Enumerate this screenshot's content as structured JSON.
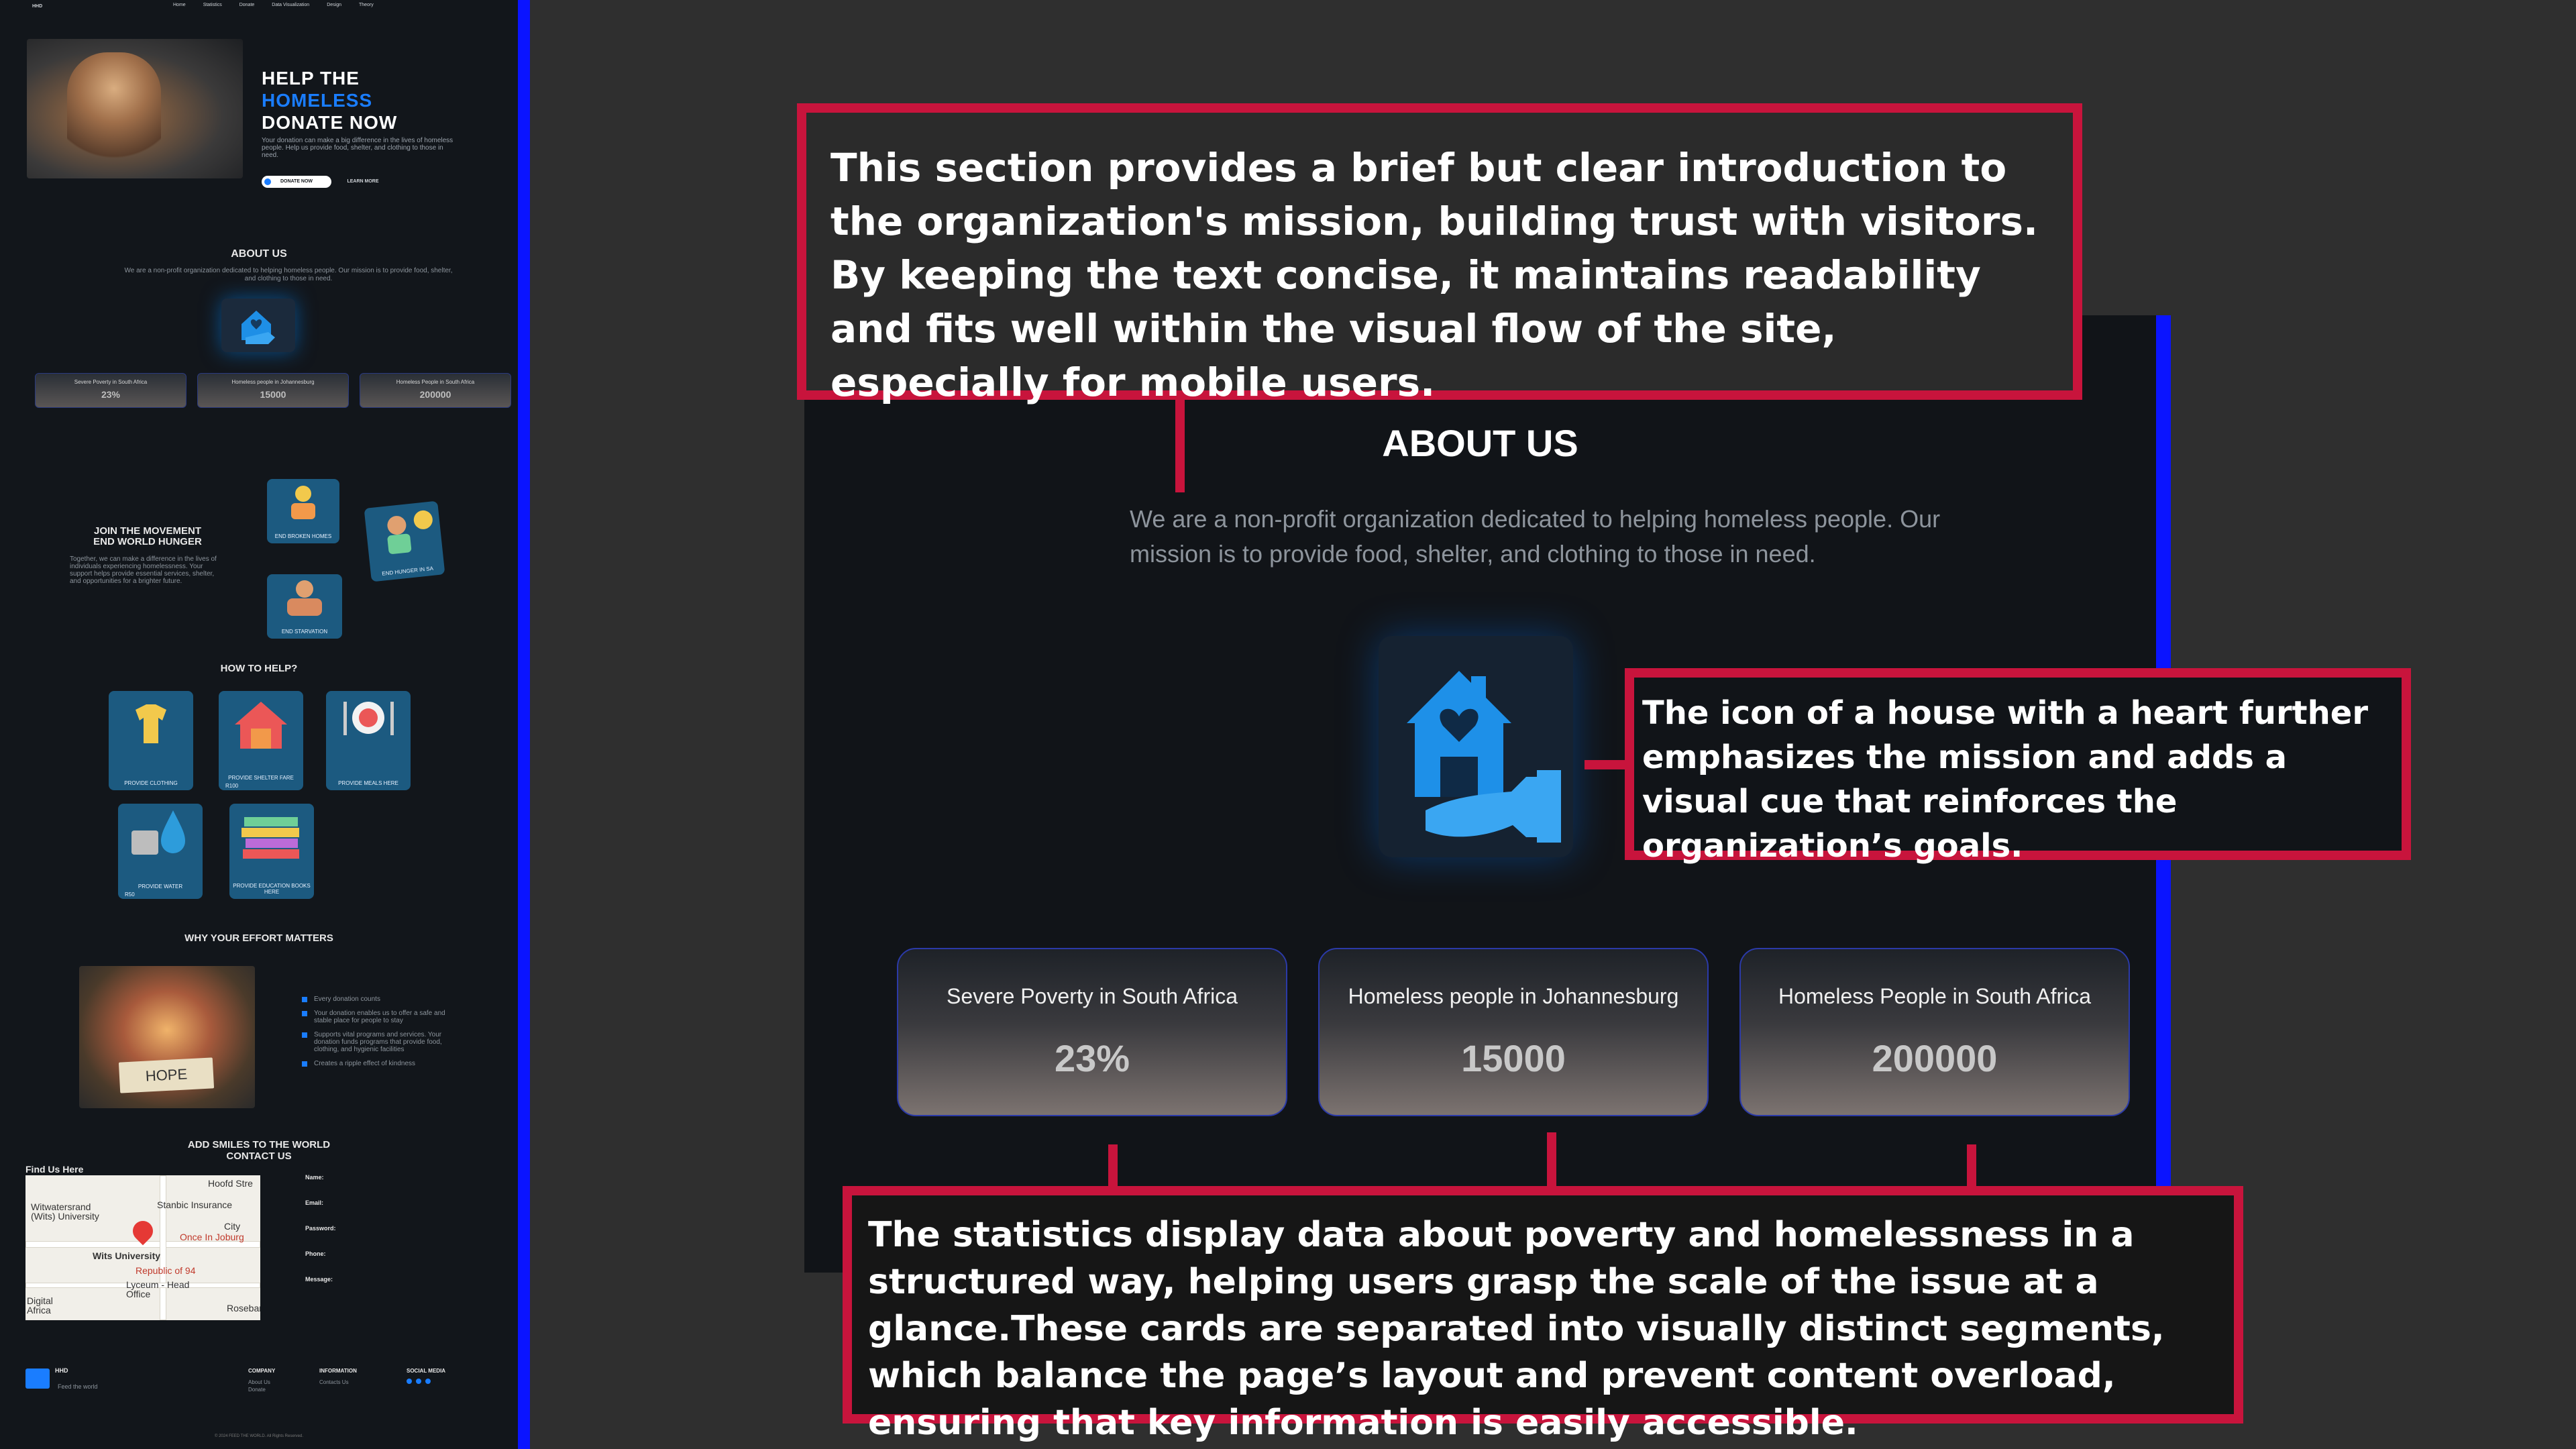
{
  "thumbnail": {
    "nav": {
      "logo": "HHD",
      "links": [
        "Home",
        "Statistics",
        "Donate",
        "Data Visualization",
        "Design",
        "Theory"
      ]
    },
    "hero": {
      "title_line1": "HELP THE",
      "title_line2": "HOMELESS",
      "title_line3": "DONATE NOW",
      "text": "Your donation can make a big difference in the lives of homeless people. Help us provide food, shelter, and clothing to those in need.",
      "donate_button": "DONATE NOW",
      "learn_button": "LEARN MORE"
    },
    "about": {
      "heading": "ABOUT US",
      "text": "We are a non-profit organization dedicated to helping homeless people. Our mission is to provide food, shelter, and clothing to those in need.",
      "stats": [
        {
          "label": "Severe Poverty in South Africa",
          "value": "23%"
        },
        {
          "label": "Homeless people in Johannesburg",
          "value": "15000"
        },
        {
          "label": "Homeless People in South Africa",
          "value": "200000"
        }
      ]
    },
    "join": {
      "heading_line1": "JOIN THE MOVEMENT",
      "heading_line2": "END WORLD HUNGER",
      "text": "Together, we can make a difference in the lives of individuals experiencing homelessness. Your support helps provide essential services, shelter, and opportunities for a brighter future.",
      "cards": [
        "END BROKEN HOMES",
        "END HUNGER IN SA",
        "END STARVATION"
      ]
    },
    "help": {
      "heading": "HOW TO HELP?",
      "cards": [
        {
          "label": "PROVIDE CLOTHING",
          "price": ""
        },
        {
          "label": "PROVIDE SHELTER FARE",
          "price": "R100"
        },
        {
          "label": "PROVIDE MEALS HERE",
          "price": ""
        },
        {
          "label": "PROVIDE WATER",
          "price": "R50"
        },
        {
          "label": "PROVIDE EDUCATION BOOKS HERE",
          "price": ""
        }
      ]
    },
    "effort": {
      "heading": "WHY YOUR EFFORT MATTERS",
      "image_text": "HOPE",
      "items": [
        "Every donation counts",
        "Your donation enables us to offer a safe and stable place for people to stay",
        "Supports vital programs and services. Your donation funds programs that provide food, clothing, and hygienic facilities",
        "Creates a ripple effect of kindness"
      ]
    },
    "contact": {
      "heading_line1": "ADD SMILES TO THE WORLD",
      "heading_line2": "CONTACT US",
      "find_us": "Find Us Here",
      "map_labels": [
        "Witwatersrand (Wits) University",
        "Stanbic Insurance",
        "Hoofd Stre",
        "City",
        "Once In Joburg",
        "Wits University",
        "Republic of 94",
        "Lyceum - Head Office",
        "Digital Africa",
        "Rosebank"
      ],
      "form_fields": [
        "Name:",
        "Email:",
        "Password:",
        "Phone:",
        "Message:"
      ]
    },
    "footer": {
      "brand": "HHD",
      "tagline": "Feed the world",
      "company_heading": "COMPANY",
      "company_links": [
        "About Us",
        "Donate"
      ],
      "info_heading": "INFORMATION",
      "info_links": [
        "Contacts Us"
      ],
      "social_heading": "SOCIAL MEDIA",
      "copyright": "© 2024 FEED THE WORLD. All Rights Reserved."
    }
  },
  "zoom": {
    "heading": "ABOUT US",
    "text": "We are a non-profit organization dedicated to helping homeless people. Our mission is to provide food, shelter, and clothing to those in need.",
    "icon": "house-heart-hand-icon",
    "stats": [
      {
        "label": "Severe Poverty in South Africa",
        "value": "23%"
      },
      {
        "label": "Homeless people in Johannesburg",
        "value": "15000"
      },
      {
        "label": "Homeless People in South Africa",
        "value": "200000"
      }
    ]
  },
  "callouts": {
    "intro": "This section provides a brief but clear introduction to the organization's mission, building trust with visitors. By keeping the text concise, it maintains readability and fits well within the visual flow of the site, especially for mobile users.",
    "icon": "The icon of a house with a heart further emphasizes the mission and adds a visual cue that reinforces the organization’s goals.",
    "stats": "The statistics display data about poverty and homelessness in a structured way, helping users grasp the scale of the issue at a glance.These cards are separated into visually distinct segments, which balance the page’s layout and prevent content overload, ensuring that key information is easily accessible."
  },
  "colors": {
    "background": "#2f2f2f",
    "page": "#12161b",
    "accent": "#1a7dff",
    "edge": "#0a14ff",
    "callout_border": "#c8143c"
  }
}
